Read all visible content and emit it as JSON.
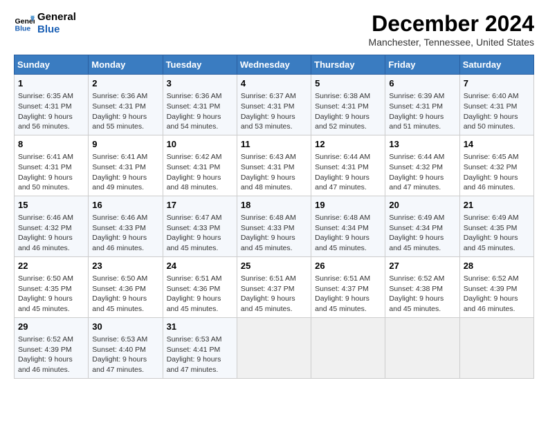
{
  "logo": {
    "line1": "General",
    "line2": "Blue"
  },
  "title": "December 2024",
  "subtitle": "Manchester, Tennessee, United States",
  "header": {
    "colors": {
      "accent": "#3a7cc1"
    }
  },
  "weekdays": [
    "Sunday",
    "Monday",
    "Tuesday",
    "Wednesday",
    "Thursday",
    "Friday",
    "Saturday"
  ],
  "weeks": [
    [
      {
        "day": 1,
        "sunrise": "6:35 AM",
        "sunset": "4:31 PM",
        "daylight": "9 hours and 56 minutes."
      },
      {
        "day": 2,
        "sunrise": "6:36 AM",
        "sunset": "4:31 PM",
        "daylight": "9 hours and 55 minutes."
      },
      {
        "day": 3,
        "sunrise": "6:36 AM",
        "sunset": "4:31 PM",
        "daylight": "9 hours and 54 minutes."
      },
      {
        "day": 4,
        "sunrise": "6:37 AM",
        "sunset": "4:31 PM",
        "daylight": "9 hours and 53 minutes."
      },
      {
        "day": 5,
        "sunrise": "6:38 AM",
        "sunset": "4:31 PM",
        "daylight": "9 hours and 52 minutes."
      },
      {
        "day": 6,
        "sunrise": "6:39 AM",
        "sunset": "4:31 PM",
        "daylight": "9 hours and 51 minutes."
      },
      {
        "day": 7,
        "sunrise": "6:40 AM",
        "sunset": "4:31 PM",
        "daylight": "9 hours and 50 minutes."
      }
    ],
    [
      {
        "day": 8,
        "sunrise": "6:41 AM",
        "sunset": "4:31 PM",
        "daylight": "9 hours and 50 minutes."
      },
      {
        "day": 9,
        "sunrise": "6:41 AM",
        "sunset": "4:31 PM",
        "daylight": "9 hours and 49 minutes."
      },
      {
        "day": 10,
        "sunrise": "6:42 AM",
        "sunset": "4:31 PM",
        "daylight": "9 hours and 48 minutes."
      },
      {
        "day": 11,
        "sunrise": "6:43 AM",
        "sunset": "4:31 PM",
        "daylight": "9 hours and 48 minutes."
      },
      {
        "day": 12,
        "sunrise": "6:44 AM",
        "sunset": "4:31 PM",
        "daylight": "9 hours and 47 minutes."
      },
      {
        "day": 13,
        "sunrise": "6:44 AM",
        "sunset": "4:32 PM",
        "daylight": "9 hours and 47 minutes."
      },
      {
        "day": 14,
        "sunrise": "6:45 AM",
        "sunset": "4:32 PM",
        "daylight": "9 hours and 46 minutes."
      }
    ],
    [
      {
        "day": 15,
        "sunrise": "6:46 AM",
        "sunset": "4:32 PM",
        "daylight": "9 hours and 46 minutes."
      },
      {
        "day": 16,
        "sunrise": "6:46 AM",
        "sunset": "4:33 PM",
        "daylight": "9 hours and 46 minutes."
      },
      {
        "day": 17,
        "sunrise": "6:47 AM",
        "sunset": "4:33 PM",
        "daylight": "9 hours and 45 minutes."
      },
      {
        "day": 18,
        "sunrise": "6:48 AM",
        "sunset": "4:33 PM",
        "daylight": "9 hours and 45 minutes."
      },
      {
        "day": 19,
        "sunrise": "6:48 AM",
        "sunset": "4:34 PM",
        "daylight": "9 hours and 45 minutes."
      },
      {
        "day": 20,
        "sunrise": "6:49 AM",
        "sunset": "4:34 PM",
        "daylight": "9 hours and 45 minutes."
      },
      {
        "day": 21,
        "sunrise": "6:49 AM",
        "sunset": "4:35 PM",
        "daylight": "9 hours and 45 minutes."
      }
    ],
    [
      {
        "day": 22,
        "sunrise": "6:50 AM",
        "sunset": "4:35 PM",
        "daylight": "9 hours and 45 minutes."
      },
      {
        "day": 23,
        "sunrise": "6:50 AM",
        "sunset": "4:36 PM",
        "daylight": "9 hours and 45 minutes."
      },
      {
        "day": 24,
        "sunrise": "6:51 AM",
        "sunset": "4:36 PM",
        "daylight": "9 hours and 45 minutes."
      },
      {
        "day": 25,
        "sunrise": "6:51 AM",
        "sunset": "4:37 PM",
        "daylight": "9 hours and 45 minutes."
      },
      {
        "day": 26,
        "sunrise": "6:51 AM",
        "sunset": "4:37 PM",
        "daylight": "9 hours and 45 minutes."
      },
      {
        "day": 27,
        "sunrise": "6:52 AM",
        "sunset": "4:38 PM",
        "daylight": "9 hours and 45 minutes."
      },
      {
        "day": 28,
        "sunrise": "6:52 AM",
        "sunset": "4:39 PM",
        "daylight": "9 hours and 46 minutes."
      }
    ],
    [
      {
        "day": 29,
        "sunrise": "6:52 AM",
        "sunset": "4:39 PM",
        "daylight": "9 hours and 46 minutes."
      },
      {
        "day": 30,
        "sunrise": "6:53 AM",
        "sunset": "4:40 PM",
        "daylight": "9 hours and 47 minutes."
      },
      {
        "day": 31,
        "sunrise": "6:53 AM",
        "sunset": "4:41 PM",
        "daylight": "9 hours and 47 minutes."
      },
      null,
      null,
      null,
      null
    ]
  ],
  "labels": {
    "sunrise": "Sunrise:",
    "sunset": "Sunset:",
    "daylight": "Daylight:"
  }
}
